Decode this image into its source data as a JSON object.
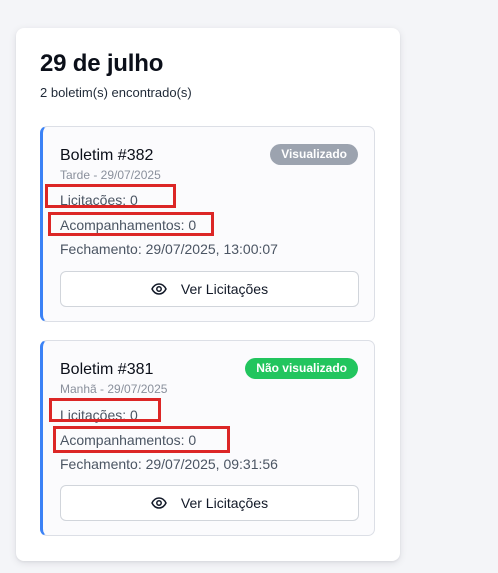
{
  "page": {
    "date_title": "29 de julho",
    "count_text": "2 boletim(s) encontrado(s)"
  },
  "colors": {
    "card_accent": "#3b82f6",
    "badge_viewed": "#9ca3af",
    "badge_not_viewed": "#22c55e",
    "highlight": "#dc2626"
  },
  "bulletins": [
    {
      "title": "Boletim #382",
      "subtitle": "Tarde - 29/07/2025",
      "status": "Visualizado",
      "licitacoes": "Licitações: 0",
      "acompanhamentos": "Acompanhamentos: 0",
      "fechamento": "Fechamento: 29/07/2025, 13:00:07",
      "button_label": "Ver Licitações",
      "button_icon": "eye-icon"
    },
    {
      "title": "Boletim #381",
      "subtitle": "Manhã - 29/07/2025",
      "status": "Não visualizado",
      "licitacoes": "Licitações: 0",
      "acompanhamentos": "Acompanhamentos: 0",
      "fechamento": "Fechamento: 29/07/2025, 09:31:56",
      "button_label": "Ver Licitações",
      "button_icon": "eye-icon"
    }
  ]
}
